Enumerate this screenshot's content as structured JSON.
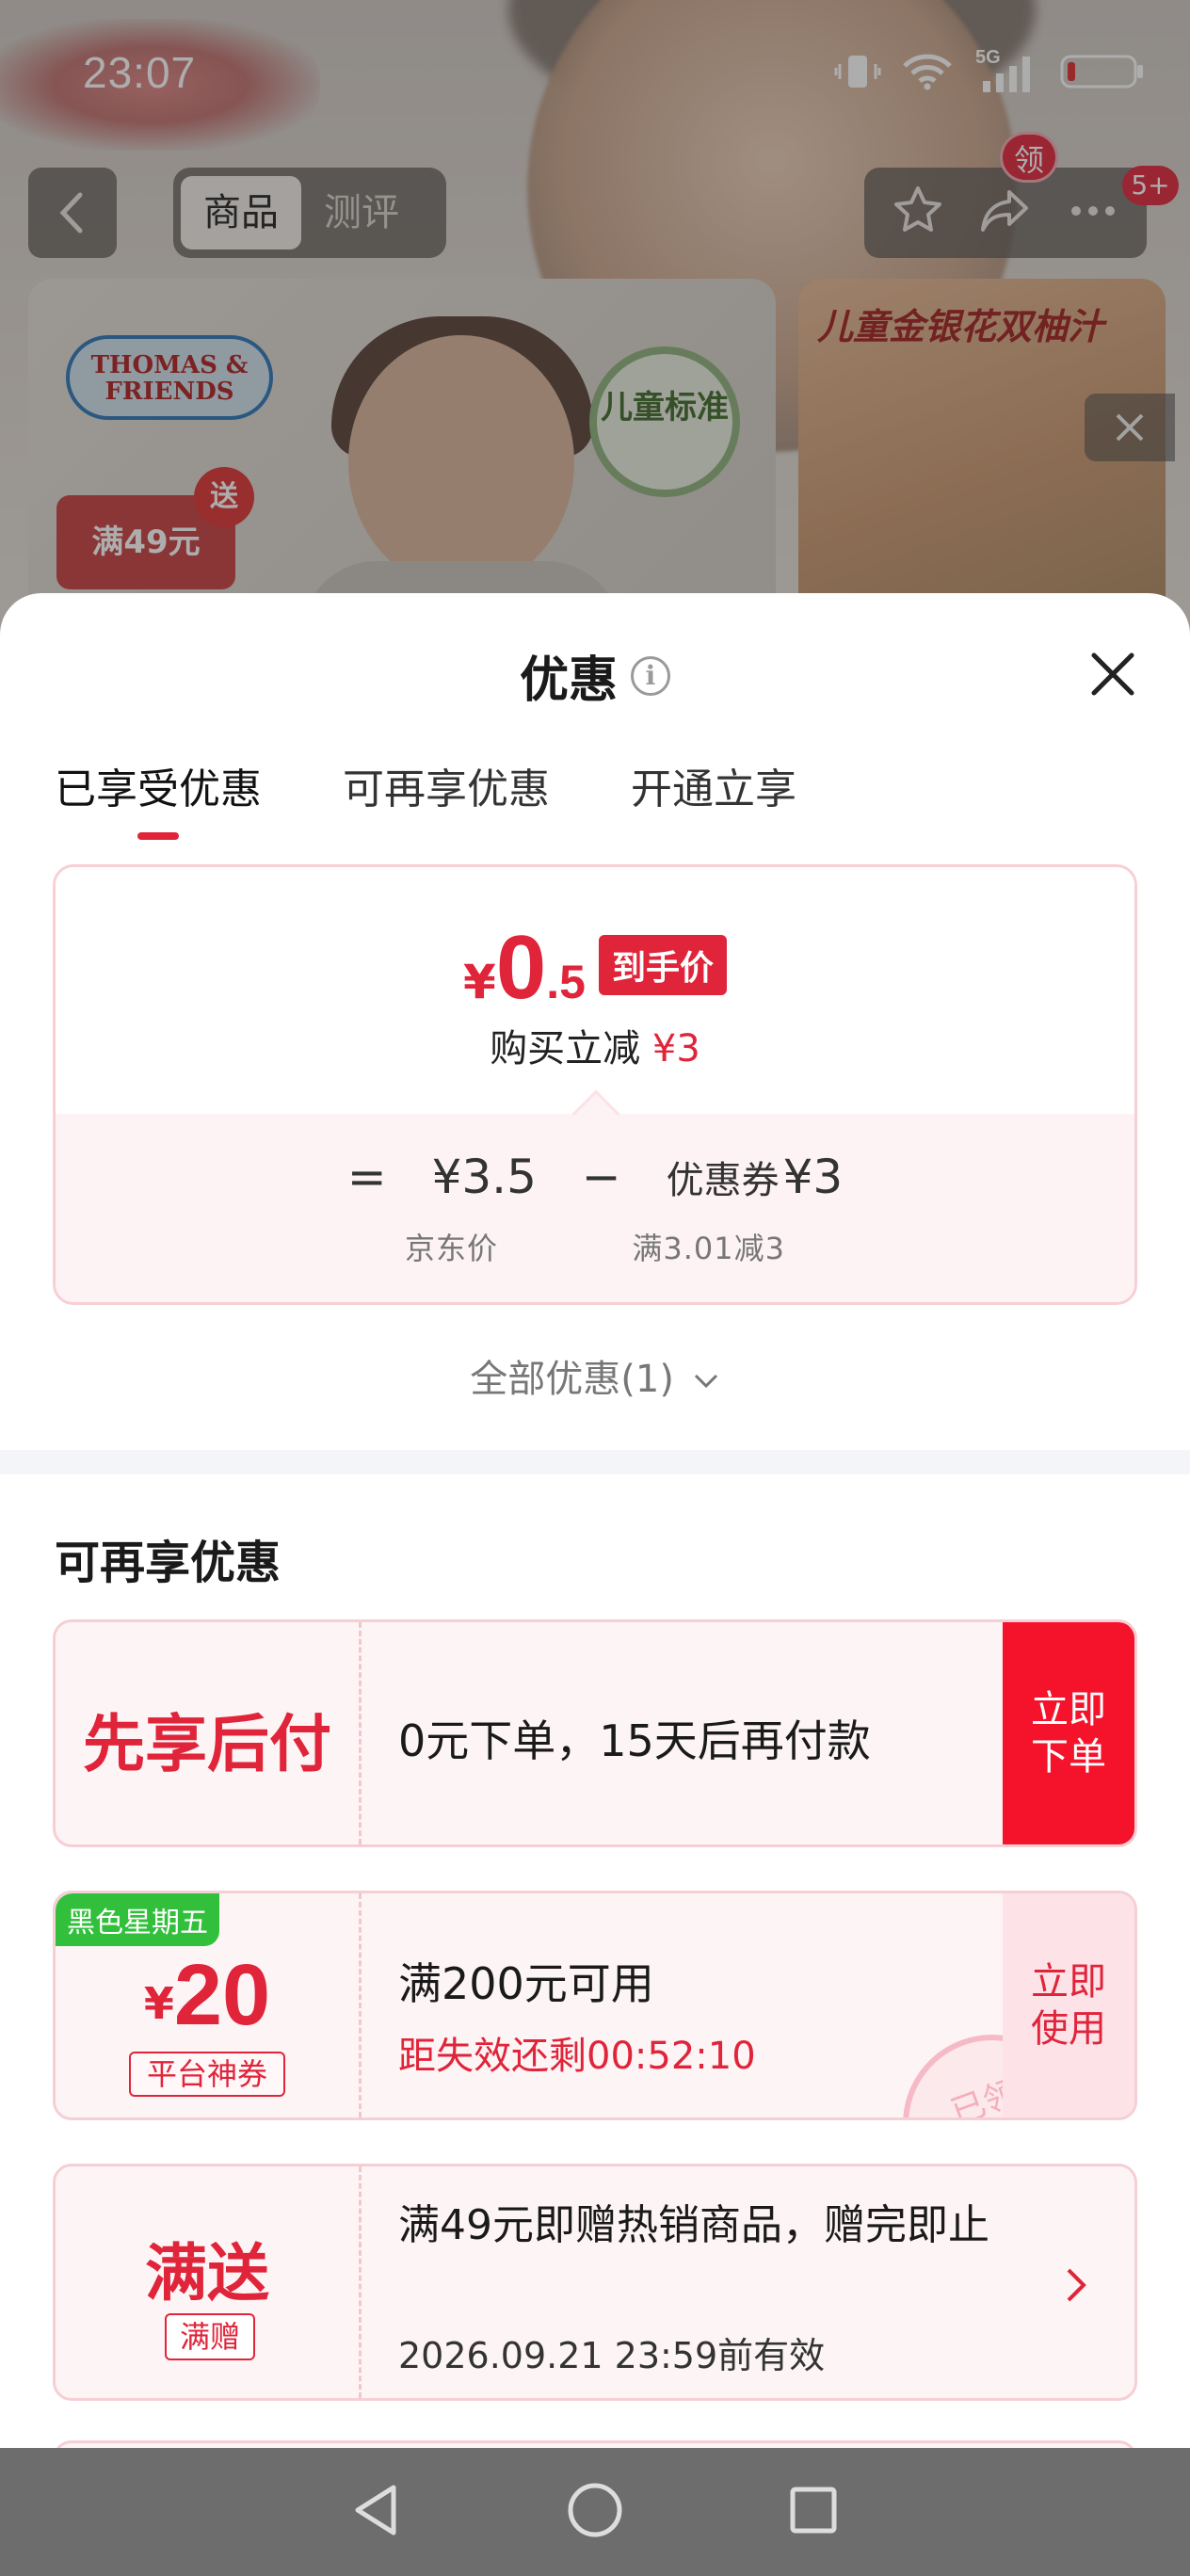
{
  "status_bar": {
    "time": "23:07",
    "network": "5G"
  },
  "nav": {
    "tabs": [
      "商品",
      "测评"
    ],
    "active_tab": 0,
    "badge_ling": "领",
    "badge_count": "5+"
  },
  "banner": {
    "brand": "THOMAS & FRIENDS",
    "seal": "儿童标准",
    "promo": "满49元",
    "send": "送",
    "side_title": "儿童金银花双柚汁"
  },
  "sheet": {
    "title": "优惠",
    "tabs": [
      "已享受优惠",
      "可再享优惠",
      "开通立享"
    ],
    "active_tab": 0,
    "enjoyed": {
      "price_currency": "¥",
      "price_int": "0",
      "price_dec": ".5",
      "price_tag": "到手价",
      "reduce_label": "购买立减",
      "reduce_amount": "¥3",
      "formula_eq": "=",
      "formula_price": "¥3.5",
      "formula_minus": "−",
      "formula_coupon_label": "优惠券",
      "formula_coupon_amount": "¥3",
      "formula_sub_left": "京东价",
      "formula_sub_right": "满3.01减3"
    },
    "all_offers": "全部优惠(1)",
    "section_title": "可再享优惠",
    "cards": {
      "c1": {
        "left": "先享后付",
        "text": "0元下单，15天后再付款",
        "action": "立即下单"
      },
      "c2": {
        "corner": "黑色星期五",
        "currency": "¥",
        "amount": "20",
        "type": "平台神券",
        "line1": "满200元可用",
        "line2": "距失效还剩00:52:10",
        "action": "立即使用",
        "stamp": "已领"
      },
      "c3": {
        "left": "满送",
        "tag": "满赠",
        "line1": "满49元即赠热销商品，赠完即止",
        "line2": "2026.09.21 23:59前有效"
      }
    }
  },
  "colors": {
    "accent": "#e0243a",
    "action_red": "#f5122b",
    "corner_green": "#32c03c"
  }
}
